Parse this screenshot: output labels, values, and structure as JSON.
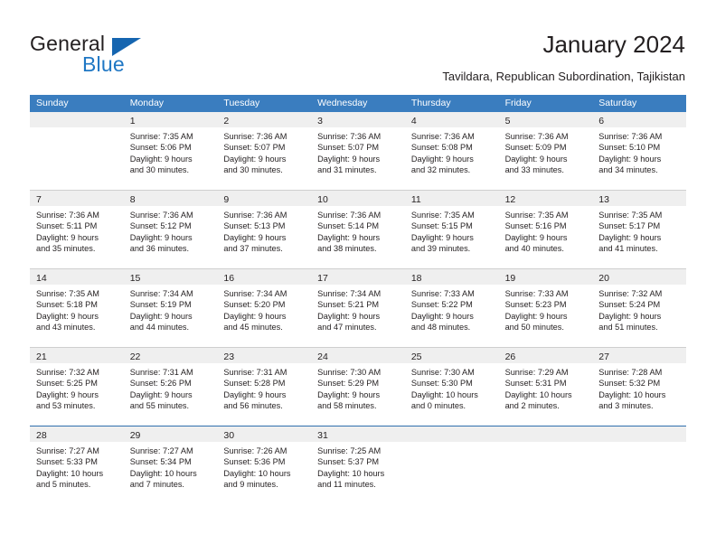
{
  "brand": {
    "name_top": "General",
    "name_bottom": "Blue",
    "triangle_icon": "blue-triangle-logo-mark",
    "color_dark": "#231f20",
    "color_blue": "#1f77c4"
  },
  "header": {
    "title": "January 2024",
    "subtitle": "Tavildara, Republican Subordination, Tajikistan"
  },
  "theme": {
    "header_row_bg": "#3a7dbf",
    "daynum_band_bg": "#efefef",
    "grid_line": "#cfcfcf",
    "accent_line": "#2f6fad",
    "text": "#231f20"
  },
  "calendar": {
    "weekdays": [
      "Sunday",
      "Monday",
      "Tuesday",
      "Wednesday",
      "Thursday",
      "Friday",
      "Saturday"
    ],
    "weeks": [
      [
        {
          "day": "",
          "lines": []
        },
        {
          "day": "1",
          "lines": [
            "Sunrise: 7:35 AM",
            "Sunset: 5:06 PM",
            "Daylight: 9 hours",
            "and 30 minutes."
          ]
        },
        {
          "day": "2",
          "lines": [
            "Sunrise: 7:36 AM",
            "Sunset: 5:07 PM",
            "Daylight: 9 hours",
            "and 30 minutes."
          ]
        },
        {
          "day": "3",
          "lines": [
            "Sunrise: 7:36 AM",
            "Sunset: 5:07 PM",
            "Daylight: 9 hours",
            "and 31 minutes."
          ]
        },
        {
          "day": "4",
          "lines": [
            "Sunrise: 7:36 AM",
            "Sunset: 5:08 PM",
            "Daylight: 9 hours",
            "and 32 minutes."
          ]
        },
        {
          "day": "5",
          "lines": [
            "Sunrise: 7:36 AM",
            "Sunset: 5:09 PM",
            "Daylight: 9 hours",
            "and 33 minutes."
          ]
        },
        {
          "day": "6",
          "lines": [
            "Sunrise: 7:36 AM",
            "Sunset: 5:10 PM",
            "Daylight: 9 hours",
            "and 34 minutes."
          ]
        }
      ],
      [
        {
          "day": "7",
          "lines": [
            "Sunrise: 7:36 AM",
            "Sunset: 5:11 PM",
            "Daylight: 9 hours",
            "and 35 minutes."
          ]
        },
        {
          "day": "8",
          "lines": [
            "Sunrise: 7:36 AM",
            "Sunset: 5:12 PM",
            "Daylight: 9 hours",
            "and 36 minutes."
          ]
        },
        {
          "day": "9",
          "lines": [
            "Sunrise: 7:36 AM",
            "Sunset: 5:13 PM",
            "Daylight: 9 hours",
            "and 37 minutes."
          ]
        },
        {
          "day": "10",
          "lines": [
            "Sunrise: 7:36 AM",
            "Sunset: 5:14 PM",
            "Daylight: 9 hours",
            "and 38 minutes."
          ]
        },
        {
          "day": "11",
          "lines": [
            "Sunrise: 7:35 AM",
            "Sunset: 5:15 PM",
            "Daylight: 9 hours",
            "and 39 minutes."
          ]
        },
        {
          "day": "12",
          "lines": [
            "Sunrise: 7:35 AM",
            "Sunset: 5:16 PM",
            "Daylight: 9 hours",
            "and 40 minutes."
          ]
        },
        {
          "day": "13",
          "lines": [
            "Sunrise: 7:35 AM",
            "Sunset: 5:17 PM",
            "Daylight: 9 hours",
            "and 41 minutes."
          ]
        }
      ],
      [
        {
          "day": "14",
          "lines": [
            "Sunrise: 7:35 AM",
            "Sunset: 5:18 PM",
            "Daylight: 9 hours",
            "and 43 minutes."
          ]
        },
        {
          "day": "15",
          "lines": [
            "Sunrise: 7:34 AM",
            "Sunset: 5:19 PM",
            "Daylight: 9 hours",
            "and 44 minutes."
          ]
        },
        {
          "day": "16",
          "lines": [
            "Sunrise: 7:34 AM",
            "Sunset: 5:20 PM",
            "Daylight: 9 hours",
            "and 45 minutes."
          ]
        },
        {
          "day": "17",
          "lines": [
            "Sunrise: 7:34 AM",
            "Sunset: 5:21 PM",
            "Daylight: 9 hours",
            "and 47 minutes."
          ]
        },
        {
          "day": "18",
          "lines": [
            "Sunrise: 7:33 AM",
            "Sunset: 5:22 PM",
            "Daylight: 9 hours",
            "and 48 minutes."
          ]
        },
        {
          "day": "19",
          "lines": [
            "Sunrise: 7:33 AM",
            "Sunset: 5:23 PM",
            "Daylight: 9 hours",
            "and 50 minutes."
          ]
        },
        {
          "day": "20",
          "lines": [
            "Sunrise: 7:32 AM",
            "Sunset: 5:24 PM",
            "Daylight: 9 hours",
            "and 51 minutes."
          ]
        }
      ],
      [
        {
          "day": "21",
          "lines": [
            "Sunrise: 7:32 AM",
            "Sunset: 5:25 PM",
            "Daylight: 9 hours",
            "and 53 minutes."
          ]
        },
        {
          "day": "22",
          "lines": [
            "Sunrise: 7:31 AM",
            "Sunset: 5:26 PM",
            "Daylight: 9 hours",
            "and 55 minutes."
          ]
        },
        {
          "day": "23",
          "lines": [
            "Sunrise: 7:31 AM",
            "Sunset: 5:28 PM",
            "Daylight: 9 hours",
            "and 56 minutes."
          ]
        },
        {
          "day": "24",
          "lines": [
            "Sunrise: 7:30 AM",
            "Sunset: 5:29 PM",
            "Daylight: 9 hours",
            "and 58 minutes."
          ]
        },
        {
          "day": "25",
          "lines": [
            "Sunrise: 7:30 AM",
            "Sunset: 5:30 PM",
            "Daylight: 10 hours",
            "and 0 minutes."
          ]
        },
        {
          "day": "26",
          "lines": [
            "Sunrise: 7:29 AM",
            "Sunset: 5:31 PM",
            "Daylight: 10 hours",
            "and 2 minutes."
          ]
        },
        {
          "day": "27",
          "lines": [
            "Sunrise: 7:28 AM",
            "Sunset: 5:32 PM",
            "Daylight: 10 hours",
            "and 3 minutes."
          ]
        }
      ],
      [
        {
          "day": "28",
          "lines": [
            "Sunrise: 7:27 AM",
            "Sunset: 5:33 PM",
            "Daylight: 10 hours",
            "and 5 minutes."
          ]
        },
        {
          "day": "29",
          "lines": [
            "Sunrise: 7:27 AM",
            "Sunset: 5:34 PM",
            "Daylight: 10 hours",
            "and 7 minutes."
          ]
        },
        {
          "day": "30",
          "lines": [
            "Sunrise: 7:26 AM",
            "Sunset: 5:36 PM",
            "Daylight: 10 hours",
            "and 9 minutes."
          ]
        },
        {
          "day": "31",
          "lines": [
            "Sunrise: 7:25 AM",
            "Sunset: 5:37 PM",
            "Daylight: 10 hours",
            "and 11 minutes."
          ]
        },
        {
          "day": "",
          "lines": []
        },
        {
          "day": "",
          "lines": []
        },
        {
          "day": "",
          "lines": []
        }
      ]
    ]
  }
}
